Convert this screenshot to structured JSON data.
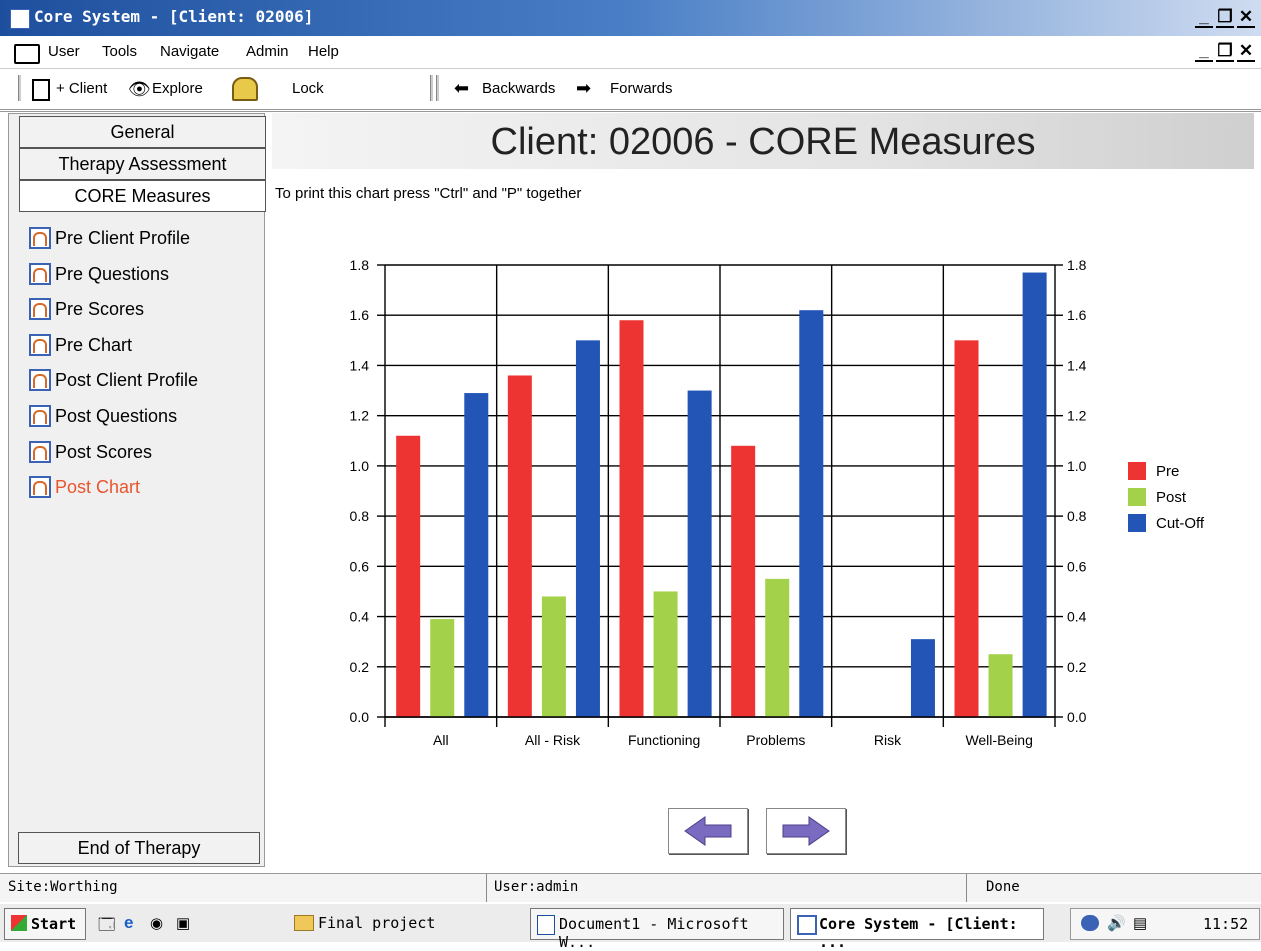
{
  "window": {
    "title": "Core System - [Client: 02006]"
  },
  "menu": [
    "User",
    "Tools",
    "Navigate",
    "Admin",
    "Help"
  ],
  "toolbar": {
    "new_client": "+ Client",
    "explore": "Explore",
    "lock": "Lock",
    "backwards": "Backwards",
    "forwards": "Forwards"
  },
  "sidebar": {
    "sections": [
      "General",
      "Therapy Assessment",
      "CORE Measures"
    ],
    "links": [
      {
        "label": "Pre Client Profile",
        "active": false
      },
      {
        "label": "Pre Questions",
        "active": false
      },
      {
        "label": "Pre Scores",
        "active": false
      },
      {
        "label": "Pre Chart",
        "active": false
      },
      {
        "label": "Post Client Profile",
        "active": false
      },
      {
        "label": "Post Questions",
        "active": false
      },
      {
        "label": "Post Scores",
        "active": false
      },
      {
        "label": "Post Chart",
        "active": true
      }
    ],
    "bottom_button": "End of Therapy"
  },
  "main": {
    "title": "Client: 02006 - CORE Measures",
    "print_note": "To print this chart press \"Ctrl\" and \"P\" together"
  },
  "chart_data": {
    "type": "bar",
    "categories": [
      "All",
      "All - Risk",
      "Functioning",
      "Problems",
      "Risk",
      "Well-Being"
    ],
    "series": [
      {
        "name": "Pre",
        "color": "#ee3333",
        "values": [
          1.12,
          1.36,
          1.58,
          1.08,
          0,
          1.5
        ]
      },
      {
        "name": "Post",
        "color": "#a3d14a",
        "values": [
          0.39,
          0.48,
          0.5,
          0.55,
          0,
          0.25
        ]
      },
      {
        "name": "Cut-Off",
        "color": "#2255b5",
        "values": [
          1.29,
          1.5,
          1.3,
          1.62,
          0.31,
          1.77
        ]
      }
    ],
    "ylim": [
      0,
      1.8
    ],
    "yticks": [
      "0.0",
      "0.2",
      "0.4",
      "0.6",
      "0.8",
      "1.0",
      "1.2",
      "1.4",
      "1.6",
      "1.8"
    ],
    "grid": true,
    "legend_position": "right"
  },
  "statusbar": {
    "site": "Site:Worthing",
    "user": "User:admin",
    "state": "Done"
  },
  "taskbar": {
    "start": "Start",
    "tasks": [
      "Final project",
      "Document1 - Microsoft W...",
      "Core System - [Client: ..."
    ],
    "clock": "11:52"
  }
}
